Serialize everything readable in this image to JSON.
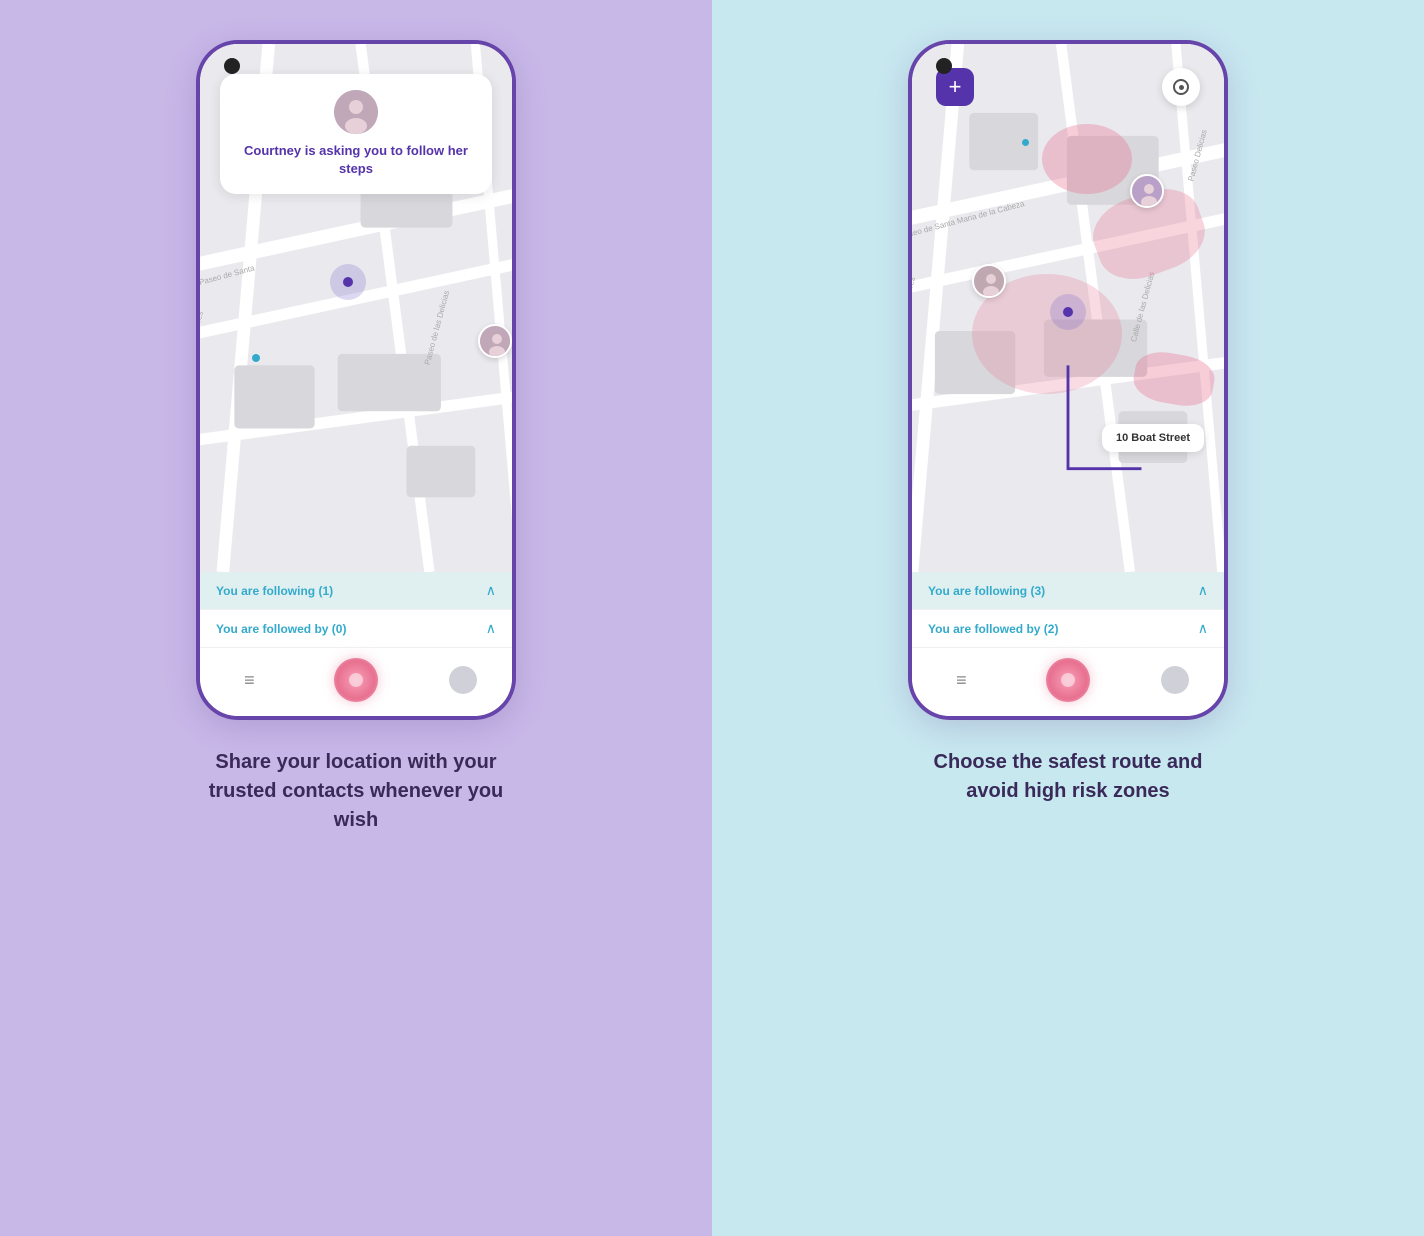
{
  "left_panel": {
    "bg_color": "#c8b8e8",
    "phone": {
      "notification": {
        "text": "Courtney is asking you to follow her steps"
      },
      "following_row1": {
        "label": "You are following (1)",
        "chevron": "^"
      },
      "following_row2": {
        "label": "You are followed by (0)",
        "chevron": "^"
      }
    },
    "caption": "Share your location with your trusted contacts whenever you wish"
  },
  "right_panel": {
    "bg_color": "#c8e8f0",
    "phone": {
      "plus_label": "+",
      "address_bubble": "10 Boat Street",
      "following_row1": {
        "label": "You are following (3)",
        "chevron": "^"
      },
      "following_row2": {
        "label": "You are followed by (2)",
        "chevron": "^"
      }
    },
    "caption": "Choose the safest route and avoid high risk zones"
  },
  "icons": {
    "menu": "≡",
    "chevron_up": "∧",
    "plus": "+",
    "locate": "◎"
  }
}
